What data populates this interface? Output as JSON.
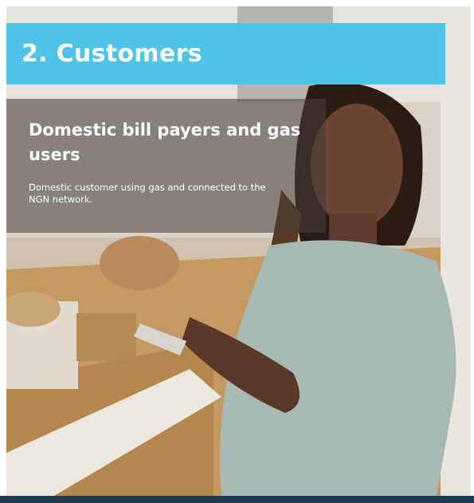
{
  "slide": {
    "title": "2. Customers",
    "section_heading": "Domestic bill payers and gas users",
    "section_body": "Domestic customer using gas and connected to the NGN network."
  },
  "colors": {
    "title_bar": "#4fc3e8",
    "footer_bar": "#1d3a55",
    "overlay": "rgba(70,62,58,0.55)"
  }
}
